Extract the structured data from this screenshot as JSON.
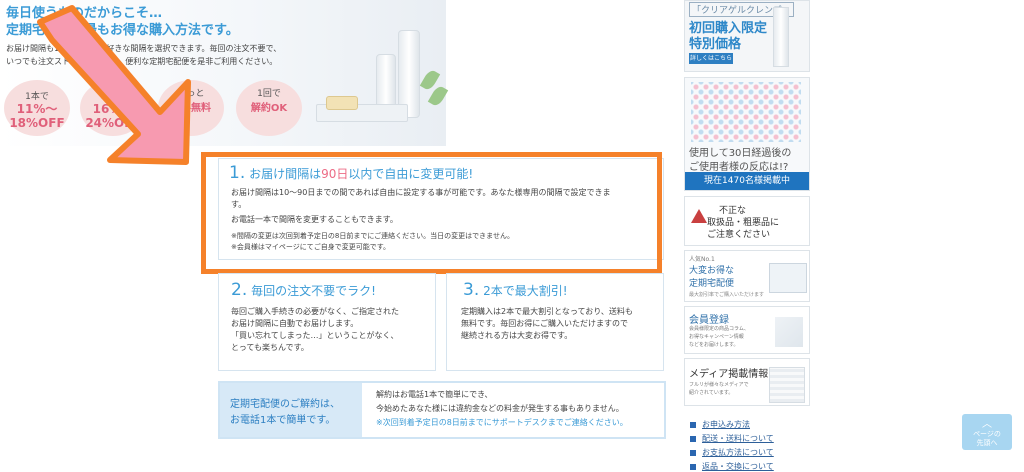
{
  "hero": {
    "title_line1": "毎日使うものだからこそ…",
    "title_line2": "定期宅配便が最もお得な購入方法です。",
    "desc_line1": "お届け間隔も10～90日でお好きな間隔を選択できます。毎回の注文不要で、",
    "desc_line2": "いつでも注文ストップ可能です。便利な定期宅配便を是非ご利用ください。",
    "circles": [
      {
        "top": "1本で",
        "main1": "11%～",
        "main2": "18%OFF"
      },
      {
        "top": "2本で",
        "main1": "16%～",
        "main2": "24%OFF"
      },
      {
        "top": "ずっと",
        "main1": "送料無料"
      },
      {
        "top": "1回で",
        "main1": "解約OK"
      }
    ]
  },
  "section1": {
    "num": "1.",
    "title_a": "お届け間隔は",
    "title_hl": "90日",
    "title_b": "以内で自由に変更可能!",
    "body1": "お届け間隔は10～90日までの間であれば自由に設定する事が可能です。あなた様専用の間隔で設定できま",
    "body2": "す。",
    "body3": "お電話一本で間隔を変更することもできます。",
    "note1": "※間隔の変更は次回到着予定日の8日前までにご連絡ください。当日の変更はできません。",
    "note2": "※会員様はマイページにてご自身で変更可能です。"
  },
  "section2": {
    "num": "2.",
    "title": "毎回の注文不要でラク!",
    "lines": [
      "毎回ご購入手続きの必要がなく、ご指定された",
      "お届け間隔に自動でお届けします。",
      "「買い忘れてしまった…」ということがなく、",
      "とっても楽ちんです。"
    ]
  },
  "section3": {
    "num": "3.",
    "title": "2本で最大割引!",
    "lines": [
      "定期購入は2本で最大割引となっており、送料も",
      "無料です。毎回お得にご購入いただけますので",
      "継続される方は大変お得です。"
    ]
  },
  "contact": {
    "left1": "定期宅配便のご解約は、",
    "left2": "お電話1本で簡単です。",
    "right1": "解約はお電話1本で簡単にでき、",
    "right2": "今始めたあなた様には違約金などの料金が発生する事もありません。",
    "right3": "※次回到着予定日の8日前までにサポートデスクまでご連絡ください。"
  },
  "sidebar": {
    "b1_tag": "「クリアゲルクレンズ」",
    "b1_line1": "初回購入限定",
    "b1_line2": "特別価格",
    "b1_btn": "詳しくはこちら",
    "b2_line1": "使用して30日経過後の",
    "b2_line2": "ご使用者様の反応は!?",
    "b2_bar": "現在1470名様掲載中",
    "b3_line1": "不正な",
    "b3_line2": "取扱品・粗悪品に",
    "b3_line3": "ご注意ください",
    "b4_small": "人気No.1",
    "b4_line1": "大変お得な",
    "b4_line2": "定期宅配便",
    "b4_sub": "最大割引率でご購入いただけます",
    "b5_title": "会員登録",
    "b5_d1": "会員様限定の商品コラム、",
    "b5_d2": "お得なキャンペーン情報",
    "b5_d3": "などをお届けします。",
    "b6_title": "メディア掲載情報",
    "b6_d1": "フルリが様々なメディアで",
    "b6_d2": "紹介されています。"
  },
  "links": [
    "お申込み方法",
    "配送・送料について",
    "お支払方法について",
    "返品・交換について"
  ],
  "totop": {
    "chev": "︿",
    "l1": "ページの",
    "l2": "先頭へ"
  },
  "colors": {
    "accent_blue": "#3b9bd6",
    "highlight_orange": "#f5812a",
    "pink": "#e0607a",
    "nav_blue": "#1f74bf"
  }
}
